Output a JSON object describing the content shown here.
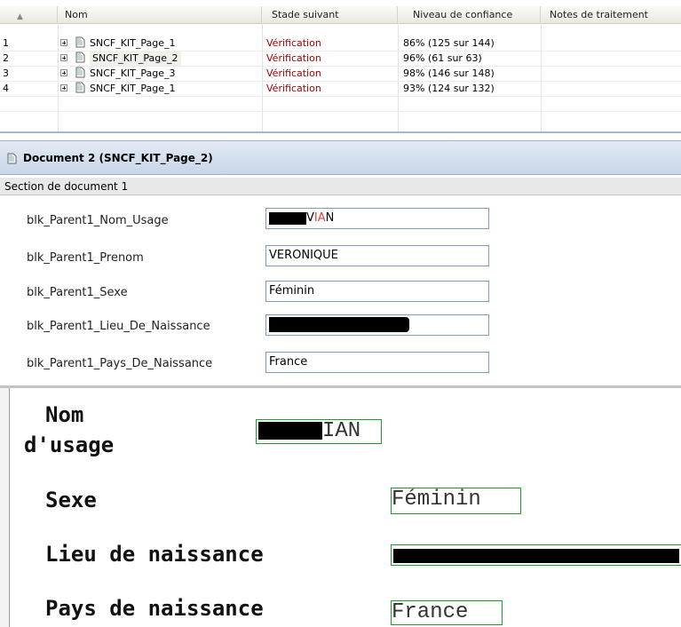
{
  "grid": {
    "columns": [
      "Nom",
      "Stade suivant",
      "Niveau de confiance",
      "Notes de traitement"
    ],
    "rows": [
      {
        "num": "1",
        "name": "SNCF_KIT_Page_1",
        "stage": "Vérification",
        "confidence": "86% (125 sur 144)"
      },
      {
        "num": "2",
        "name": "SNCF_KIT_Page_2",
        "stage": "Vérification",
        "confidence": "96% (61 sur 63)"
      },
      {
        "num": "3",
        "name": "SNCF_KIT_Page_3",
        "stage": "Vérification",
        "confidence": "98% (146 sur 148)"
      },
      {
        "num": "4",
        "name": "SNCF_KIT_Page_1",
        "stage": "Vérification",
        "confidence": "93% (124 sur 132)"
      }
    ]
  },
  "document": {
    "title": "Document 2 (SNCF_KIT_Page_2)",
    "section": "Section de document 1",
    "fields": [
      {
        "label": "blk_Parent1_Nom_Usage",
        "value_pre": "V",
        "value_hl": "IA",
        "value_post": "N"
      },
      {
        "label": "blk_Parent1_Prenom",
        "value": "VERONIQUE"
      },
      {
        "label": "blk_Parent1_Sexe",
        "value": "Féminin"
      },
      {
        "label": "blk_Parent1_Lieu_De_Naissance",
        "value": ""
      },
      {
        "label": "blk_Parent1_Pays_De_Naissance",
        "value": "France"
      }
    ]
  },
  "preview": {
    "nom_line1": "Nom",
    "nom_line2": "d'usage",
    "nom_ocr": "IAN",
    "sexe_label": "Sexe",
    "sexe_ocr": "Féminin",
    "lieu_label": "Lieu de naissance",
    "pays_label": "Pays de naissance",
    "pays_ocr": "France"
  },
  "colors": {
    "stage": "#a00000",
    "ocr_box": "#1f9a2f",
    "header_blue": "#c9d6e8"
  }
}
